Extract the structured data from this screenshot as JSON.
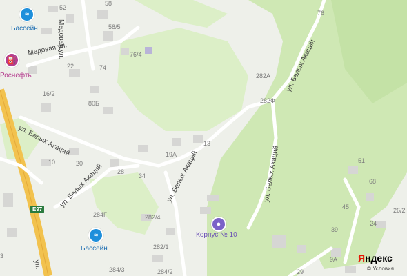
{
  "map": {
    "colors": {
      "land": "#eef0ea",
      "forest": "#cfe8b4",
      "forest_light": "#dcefc7",
      "road": "#ffffff",
      "highway": "#f2c24e",
      "building": "#d6d6d4",
      "water_poi": "#1e8fdb",
      "fuel_poi": "#b43c8e",
      "building_poi": "#7b62c8",
      "route_shield": "#2b7b3f"
    },
    "streets": {
      "medovaya_vertical": "Медовая ул.",
      "medovaya_horizontal": "Медовая ул.",
      "belykh_akatsiy_1": "ул. Белых Акаций",
      "belykh_akatsiy_2": "ул. Белых Акаций",
      "belykh_akatsiy_3": "ул. Белых Акаций",
      "belykh_akatsiy_4": "ул. Белых Акаций",
      "belykh_akatsiy_5": "ул. Белых Акаций",
      "partial_ul": "ул."
    },
    "pois": {
      "pool_top": "Бассейн",
      "fuel": "Роснефть",
      "pool_bottom": "Бассейн",
      "korpus": "Корпус № 10"
    },
    "route": "E97",
    "house_numbers": {
      "n52": "52",
      "n58": "58",
      "n58_5": "58/5",
      "n76_4": "76/4",
      "n74": "74",
      "n22": "22",
      "n16_2": "16/2",
      "n80b": "80Б",
      "n10": "10",
      "n20": "20",
      "n28": "28",
      "n34": "34",
      "n19a": "19А",
      "n13": "13",
      "n282a": "282А",
      "n282f": "282Ф",
      "n76": "76",
      "n51": "51",
      "n68": "68",
      "n45": "45",
      "n26_2": "26/2",
      "n24": "24",
      "n39": "39",
      "n9a": "9А",
      "n29": "29",
      "n284g": "284Г",
      "n282_4": "282/4",
      "n282_1": "282/1",
      "n284_3": "284/3",
      "n284_2": "284/2",
      "n3": "3"
    },
    "branding": {
      "brand_first": "Я",
      "brand_rest": "ндекс",
      "terms": "© Условия"
    }
  }
}
